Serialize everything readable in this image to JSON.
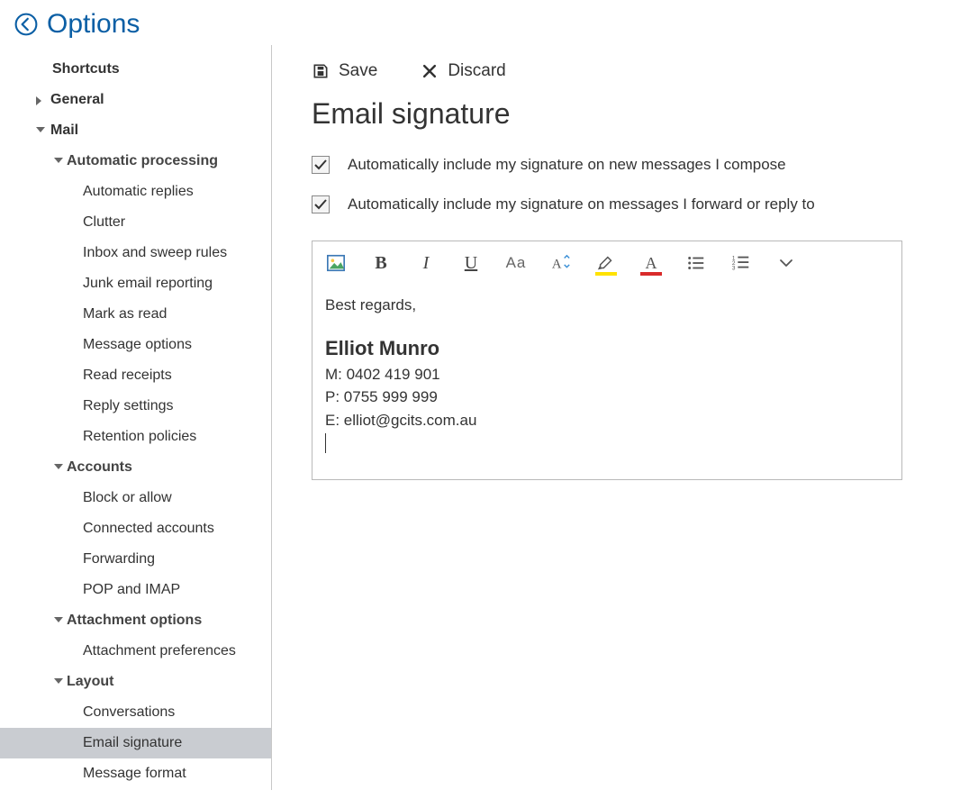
{
  "header": {
    "title": "Options"
  },
  "sidebar": {
    "shortcuts": "Shortcuts",
    "general": "General",
    "mail": "Mail",
    "sections": {
      "automatic_processing": {
        "label": "Automatic processing",
        "items": {
          "automatic_replies": "Automatic replies",
          "clutter": "Clutter",
          "inbox_sweep": "Inbox and sweep rules",
          "junk_email": "Junk email reporting",
          "mark_as_read": "Mark as read",
          "message_options": "Message options",
          "read_receipts": "Read receipts",
          "reply_settings": "Reply settings",
          "retention_policies": "Retention policies"
        }
      },
      "accounts": {
        "label": "Accounts",
        "items": {
          "block_allow": "Block or allow",
          "connected_accounts": "Connected accounts",
          "forwarding": "Forwarding",
          "pop_imap": "POP and IMAP"
        }
      },
      "attachment_options": {
        "label": "Attachment options",
        "items": {
          "attachment_preferences": "Attachment preferences"
        }
      },
      "layout": {
        "label": "Layout",
        "items": {
          "conversations": "Conversations",
          "email_signature": "Email signature",
          "message_format": "Message format"
        }
      }
    }
  },
  "actions": {
    "save": "Save",
    "discard": "Discard"
  },
  "page": {
    "title": "Email signature"
  },
  "checkboxes": {
    "include_new": {
      "label": "Automatically include my signature on new messages I compose",
      "checked": true
    },
    "include_reply": {
      "label": "Automatically include my signature on messages I forward or reply to",
      "checked": true
    }
  },
  "toolbar_icons": {
    "insert_image": "insert-image-icon",
    "bold": "bold-icon",
    "italic": "italic-icon",
    "underline": "underline-icon",
    "font_family": "font-family-icon",
    "font_size": "font-size-icon",
    "highlight": "highlight-icon",
    "font_color": "font-color-icon",
    "bullets": "bullets-icon",
    "numbering": "numbering-icon",
    "more": "more-icon"
  },
  "signature": {
    "greeting": "Best regards,",
    "name": "Elliot Munro",
    "mobile": "M: 0402 419 901",
    "phone": "P: 0755 999 999",
    "email": "E: elliot@gcits.com.au"
  }
}
